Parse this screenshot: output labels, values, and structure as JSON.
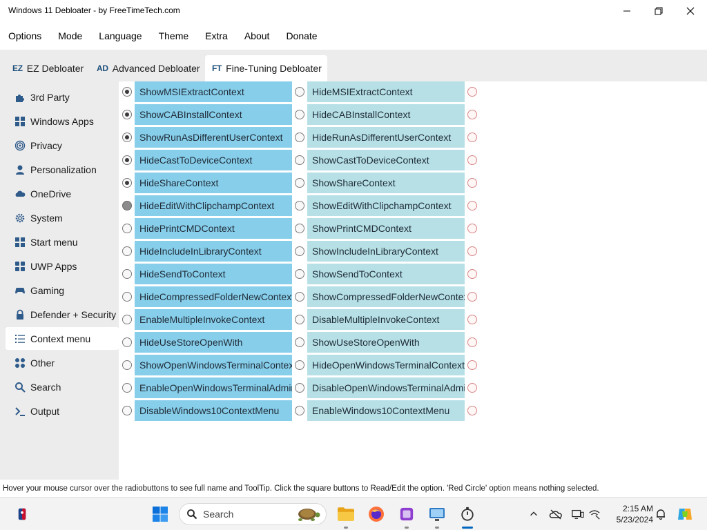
{
  "window": {
    "title": "Windows 11 Debloater - by FreeTimeTech.com"
  },
  "menubar": [
    "Options",
    "Mode",
    "Language",
    "Theme",
    "Extra",
    "About",
    "Donate"
  ],
  "tabs": [
    {
      "abbr": "EZ",
      "label": "EZ Debloater",
      "active": false
    },
    {
      "abbr": "AD",
      "label": "Advanced Debloater",
      "active": false
    },
    {
      "abbr": "FT",
      "label": "Fine-Tuning Debloater",
      "active": true
    }
  ],
  "sidebar": [
    {
      "label": "3rd Party",
      "icon": "puzzle-icon"
    },
    {
      "label": "Windows Apps",
      "icon": "windows-icon"
    },
    {
      "label": "Privacy",
      "icon": "fingerprint-icon"
    },
    {
      "label": "Personalization",
      "icon": "person-icon"
    },
    {
      "label": "OneDrive",
      "icon": "cloud-icon"
    },
    {
      "label": "System",
      "icon": "gear-icon"
    },
    {
      "label": "Start menu",
      "icon": "start-menu-icon"
    },
    {
      "label": "UWP Apps",
      "icon": "grid-icon"
    },
    {
      "label": "Gaming",
      "icon": "gamepad-icon"
    },
    {
      "label": "Defender + Security",
      "icon": "lock-icon"
    },
    {
      "label": "Context menu",
      "icon": "list-icon",
      "active": true
    },
    {
      "label": "Other",
      "icon": "apps-icon"
    },
    {
      "label": "Search",
      "icon": "search-icon"
    },
    {
      "label": "Output",
      "icon": "terminal-icon"
    }
  ],
  "options": [
    {
      "a": "ShowMSIExtractContext",
      "b": "HideMSIExtractContext",
      "state": "a"
    },
    {
      "a": "ShowCABInstallContext",
      "b": "HideCABInstallContext",
      "state": "a"
    },
    {
      "a": "ShowRunAsDifferentUserContext",
      "b": "HideRunAsDifferentUserContext",
      "state": "a"
    },
    {
      "a": "HideCastToDeviceContext",
      "b": "ShowCastToDeviceContext",
      "state": "a"
    },
    {
      "a": "HideShareContext",
      "b": "ShowShareContext",
      "state": "a"
    },
    {
      "a": "HideEditWithClipchampContext",
      "b": "ShowEditWithClipchampContext",
      "state": "hover"
    },
    {
      "a": "HidePrintCMDContext",
      "b": "ShowPrintCMDContext",
      "state": "none"
    },
    {
      "a": "HideIncludeInLibraryContext",
      "b": "ShowIncludeInLibraryContext",
      "state": "none"
    },
    {
      "a": "HideSendToContext",
      "b": "ShowSendToContext",
      "state": "none"
    },
    {
      "a": "HideCompressedFolderNewContext",
      "b": "ShowCompressedFolderNewContext",
      "state": "none"
    },
    {
      "a": "EnableMultipleInvokeContext",
      "b": "DisableMultipleInvokeContext",
      "state": "none"
    },
    {
      "a": "HideUseStoreOpenWith",
      "b": "ShowUseStoreOpenWith",
      "state": "none"
    },
    {
      "a": "ShowOpenWindowsTerminalContext",
      "b": "HideOpenWindowsTerminalContext",
      "state": "none"
    },
    {
      "a": "EnableOpenWindowsTerminalAdminContext",
      "b": "DisableOpenWindowsTerminalAdminContext",
      "state": "none"
    },
    {
      "a": "DisableWindows10ContextMenu",
      "b": "EnableWindows10ContextMenu",
      "state": "none"
    }
  ],
  "statusbar": {
    "text": "Hover your mouse cursor over the radiobuttons to see full name and ToolTip. Click the square buttons to Read/Edit the option. 'Red Circle' option means nothing selected."
  },
  "taskbar": {
    "search_placeholder": "Search",
    "time": "2:15 AM",
    "date": "5/23/2024"
  },
  "colors": {
    "option_a": "#87ceeb",
    "option_b": "#b6e0e6",
    "sidebar_bg": "#ececec",
    "red_circle": "#d98585"
  }
}
